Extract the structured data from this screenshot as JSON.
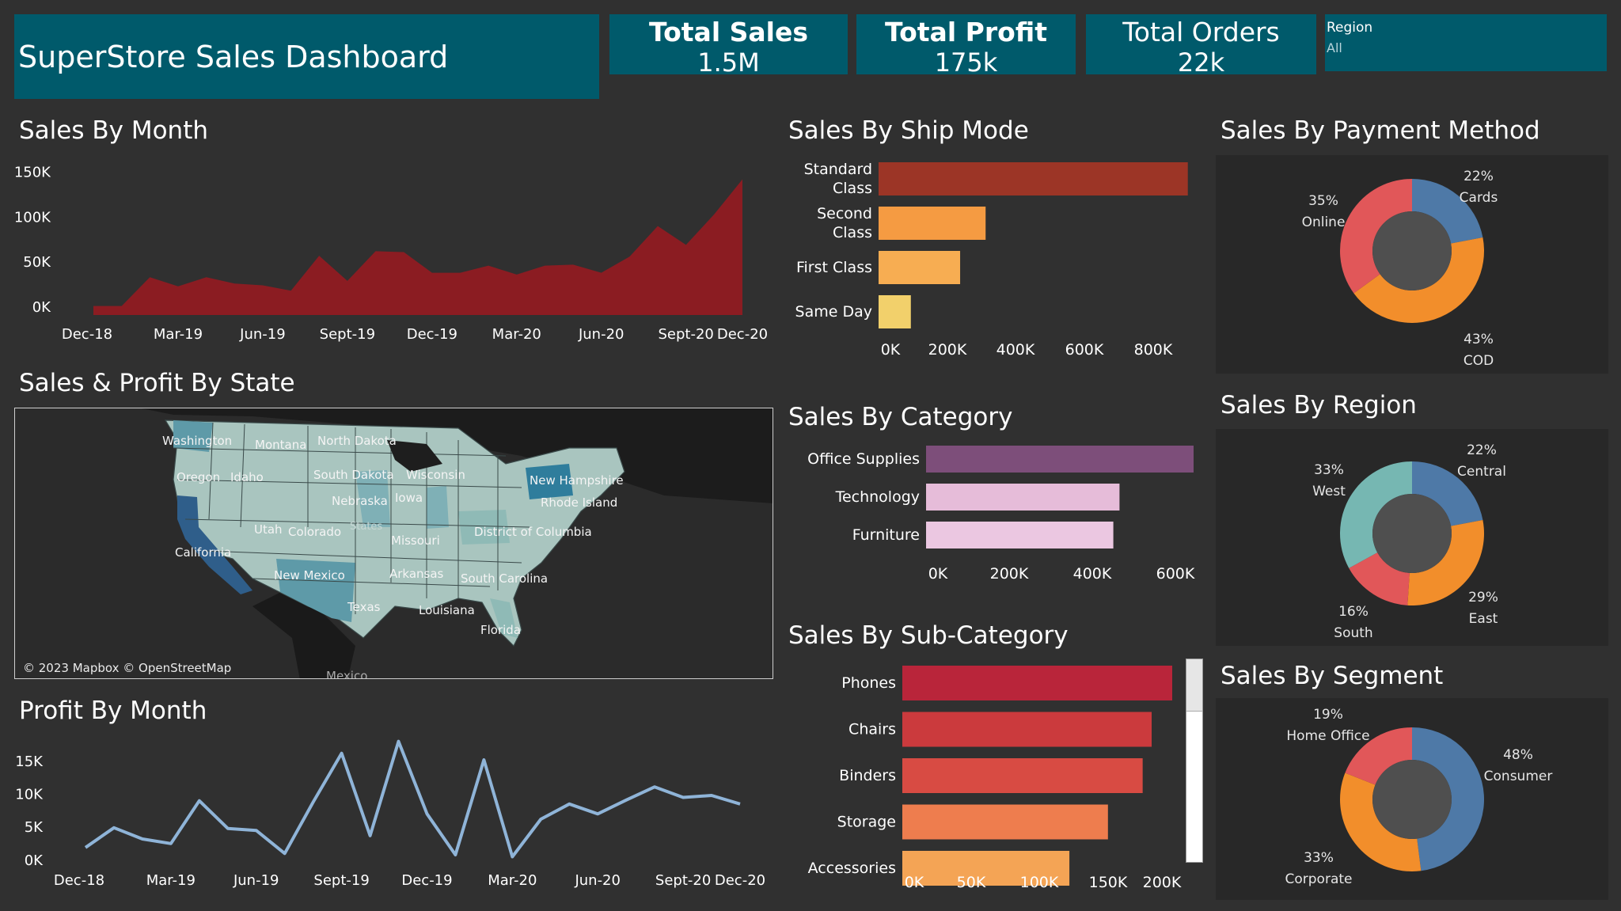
{
  "header": {
    "title": "SuperStore Sales Dashboard",
    "kpis": [
      {
        "label": "Total Sales",
        "value": "1.5M"
      },
      {
        "label": "Total Profit",
        "value": "175k"
      },
      {
        "label": "Total Orders",
        "value": "22k"
      }
    ],
    "filter": {
      "label": "Region",
      "value": "All"
    }
  },
  "titles": {
    "sales_by_month": "Sales By Month",
    "ship_mode": "Sales By Ship Mode",
    "payment": "Sales By Payment Method",
    "state": "Sales & Profit By State",
    "category": "Sales By Category",
    "region": "Sales By Region",
    "subcategory": "Sales By Sub-Category",
    "segment": "Sales By Segment",
    "profit_by_month": "Profit By Month"
  },
  "map": {
    "attribution": "© 2023 Mapbox © OpenStreetMap",
    "labels": [
      "Washington",
      "Montana",
      "North Dakota",
      "Oregon",
      "Idaho",
      "South Dakota",
      "Wisconsin",
      "New Hampshire",
      "Nebraska",
      "Iowa",
      "Rhode Island",
      "Utah",
      "Colorado",
      "Missouri",
      "District of Columbia",
      "California",
      "New Mexico",
      "Arkansas",
      "South Carolina",
      "Texas",
      "Louisiana",
      "Florida",
      "Mexico",
      "States"
    ]
  },
  "colors": {
    "kpi_bg": "#005a6b",
    "area": "#8b1c22",
    "profit_line": "#8fb4d8",
    "cat_office": "#7d4e7a",
    "cat_other": "#e6bcd9",
    "donut_blue": "#4e79a7",
    "donut_orange": "#f28e2b",
    "donut_red": "#e15759",
    "donut_teal": "#76b7b2"
  },
  "chart_data": [
    {
      "type": "area",
      "title": "Sales By Month",
      "x_tick_labels": [
        "Dec-18",
        "Mar-19",
        "Jun-19",
        "Sept-19",
        "Dec-19",
        "Mar-20",
        "Jun-20",
        "Sept-20",
        "Dec-20"
      ],
      "y_tick_labels": [
        "0K",
        "50K",
        "100K",
        "150K"
      ],
      "ylim": [
        0,
        170000
      ],
      "values": [
        10000,
        10000,
        42000,
        32000,
        42000,
        35000,
        33000,
        27000,
        66000,
        38000,
        71000,
        70000,
        47000,
        47000,
        55000,
        45000,
        55000,
        56000,
        47000,
        65000,
        99000,
        78000,
        112000,
        151000
      ]
    },
    {
      "type": "bar",
      "title": "Sales By Ship Mode",
      "categories": [
        "Standard Class",
        "Second Class",
        "First Class",
        "Same Day"
      ],
      "values": [
        910000,
        315000,
        240000,
        95000
      ],
      "x_tick_labels": [
        "0K",
        "200K",
        "400K",
        "600K",
        "800K"
      ],
      "xlim": [
        0,
        920000
      ],
      "colors": [
        "#9c3526",
        "#f59b42",
        "#f7ad52",
        "#f2d06b"
      ]
    },
    {
      "type": "pie",
      "title": "Sales By Payment Method",
      "slices": [
        {
          "label": "Cards",
          "pct": "22%",
          "value": 22,
          "color": "#4e79a7"
        },
        {
          "label": "COD",
          "pct": "43%",
          "value": 43,
          "color": "#f28e2b"
        },
        {
          "label": "Online",
          "pct": "35%",
          "value": 35,
          "color": "#e15759"
        }
      ]
    },
    {
      "type": "bar",
      "title": "Sales By Category",
      "categories": [
        "Office Supplies",
        "Technology",
        "Furniture"
      ],
      "values": [
        650000,
        470000,
        455000
      ],
      "x_tick_labels": [
        "0K",
        "200K",
        "400K",
        "600K"
      ],
      "xlim": [
        0,
        650000
      ],
      "colors": [
        "#7d4e7a",
        "#e6bcd9",
        "#ebc7e1"
      ]
    },
    {
      "type": "pie",
      "title": "Sales By Region",
      "slices": [
        {
          "label": "Central",
          "pct": "22%",
          "value": 22,
          "color": "#4e79a7"
        },
        {
          "label": "East",
          "pct": "29%",
          "value": 29,
          "color": "#f28e2b"
        },
        {
          "label": "South",
          "pct": "16%",
          "value": 16,
          "color": "#e15759"
        },
        {
          "label": "West",
          "pct": "33%",
          "value": 33,
          "color": "#76b7b2"
        }
      ]
    },
    {
      "type": "bar",
      "title": "Sales By Sub-Category",
      "categories": [
        "Phones",
        "Chairs",
        "Binders",
        "Storage",
        "Accessories"
      ],
      "values": [
        210000,
        194000,
        187000,
        160000,
        130000
      ],
      "x_tick_labels": [
        "0K",
        "50K",
        "100K",
        "150K",
        "200K"
      ],
      "xlim": [
        0,
        210000
      ],
      "colors": [
        "#b9253a",
        "#cb3a3d",
        "#d84b43",
        "#ee7d4e",
        "#f4a455"
      ]
    },
    {
      "type": "pie",
      "title": "Sales By Segment",
      "slices": [
        {
          "label": "Consumer",
          "pct": "48%",
          "value": 48,
          "color": "#4e79a7"
        },
        {
          "label": "Corporate",
          "pct": "33%",
          "value": 33,
          "color": "#f28e2b"
        },
        {
          "label": "Home Office",
          "pct": "19%",
          "value": 19,
          "color": "#e15759"
        }
      ]
    },
    {
      "type": "line",
      "title": "Profit By Month",
      "x_tick_labels": [
        "Dec-18",
        "Mar-19",
        "Jun-19",
        "Sept-19",
        "Dec-19",
        "Mar-20",
        "Jun-20",
        "Sept-20",
        "Dec-20"
      ],
      "y_tick_labels": [
        "0K",
        "5K",
        "10K",
        "15K"
      ],
      "ylim": [
        -500,
        17500
      ],
      "values": [
        1200,
        4200,
        2500,
        1800,
        8300,
        4100,
        3800,
        300,
        8100,
        15500,
        3000,
        17300,
        6300,
        100,
        14500,
        -200,
        5500,
        7800,
        6300,
        8400,
        10400,
        8800,
        9100,
        7800
      ]
    }
  ]
}
